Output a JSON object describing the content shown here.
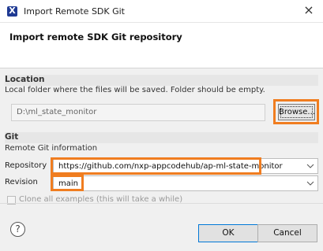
{
  "window": {
    "title": "Import Remote SDK Git",
    "close_label": "×",
    "app_icon_letter": "X"
  },
  "header": {
    "title": "Import remote SDK Git repository"
  },
  "location": {
    "section_label": "Location",
    "description": "Local folder where the files will be saved. Folder should be empty.",
    "path_value": "D:\\ml_state_monitor",
    "browse_label": "Browse..."
  },
  "git": {
    "section_label": "Git",
    "description": "Remote Git information",
    "repository_label": "Repository",
    "repository_value": "https://github.com/nxp-appcodehub/ap-ml-state-monitor",
    "revision_label": "Revision",
    "revision_value": "main",
    "clone_all_label": "Clone all examples (this will take a while)",
    "clone_all_checked": false
  },
  "footer": {
    "help_symbol": "?",
    "ok_label": "OK",
    "cancel_label": "Cancel"
  },
  "colors": {
    "highlight": "#f07d20",
    "app_icon": "#1f3a93"
  },
  "icons": {
    "app": "nxp-x-icon",
    "close": "close-icon",
    "chevron": "chevron-down-icon",
    "help": "help-icon"
  }
}
